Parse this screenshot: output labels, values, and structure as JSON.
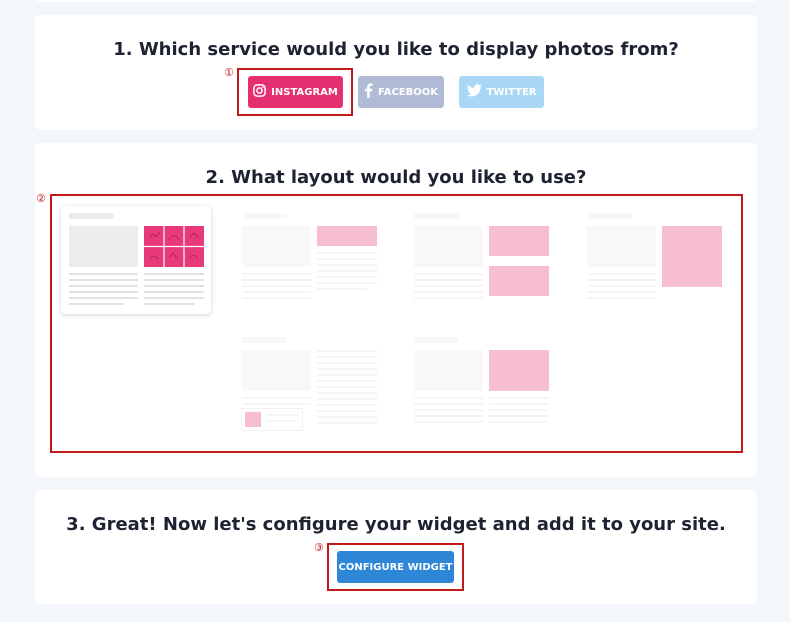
{
  "step1": {
    "number": "①",
    "title": "1. Which service would you like to display photos from?",
    "buttons": [
      {
        "label": "INSTAGRAM",
        "icon": "instagram-icon",
        "color": "#e43071",
        "selected": true
      },
      {
        "label": "FACEBOOK",
        "icon": "facebook-icon",
        "color": "#b2bbd6",
        "selected": false
      },
      {
        "label": "TWITTER",
        "icon": "twitter-icon",
        "color": "#a8d8f6",
        "selected": false
      }
    ]
  },
  "step2": {
    "number": "②",
    "title": "2. What layout would you like to use?",
    "layouts": [
      {
        "id": "grid",
        "selected": true
      },
      {
        "id": "slider",
        "selected": false
      },
      {
        "id": "two-stack",
        "selected": false
      },
      {
        "id": "single-large",
        "selected": false
      },
      {
        "id": "popup-card",
        "selected": false
      },
      {
        "id": "single-medium",
        "selected": false
      }
    ]
  },
  "step3": {
    "number": "③",
    "title": "3. Great! Now let's configure your widget and add it to your site.",
    "button_label": "CONFIGURE WIDGET",
    "button_color": "#2e87d6"
  },
  "colors": {
    "background": "#f3f6fa",
    "accent_pink": "#e8397a",
    "annotation_red": "#c2191d"
  }
}
